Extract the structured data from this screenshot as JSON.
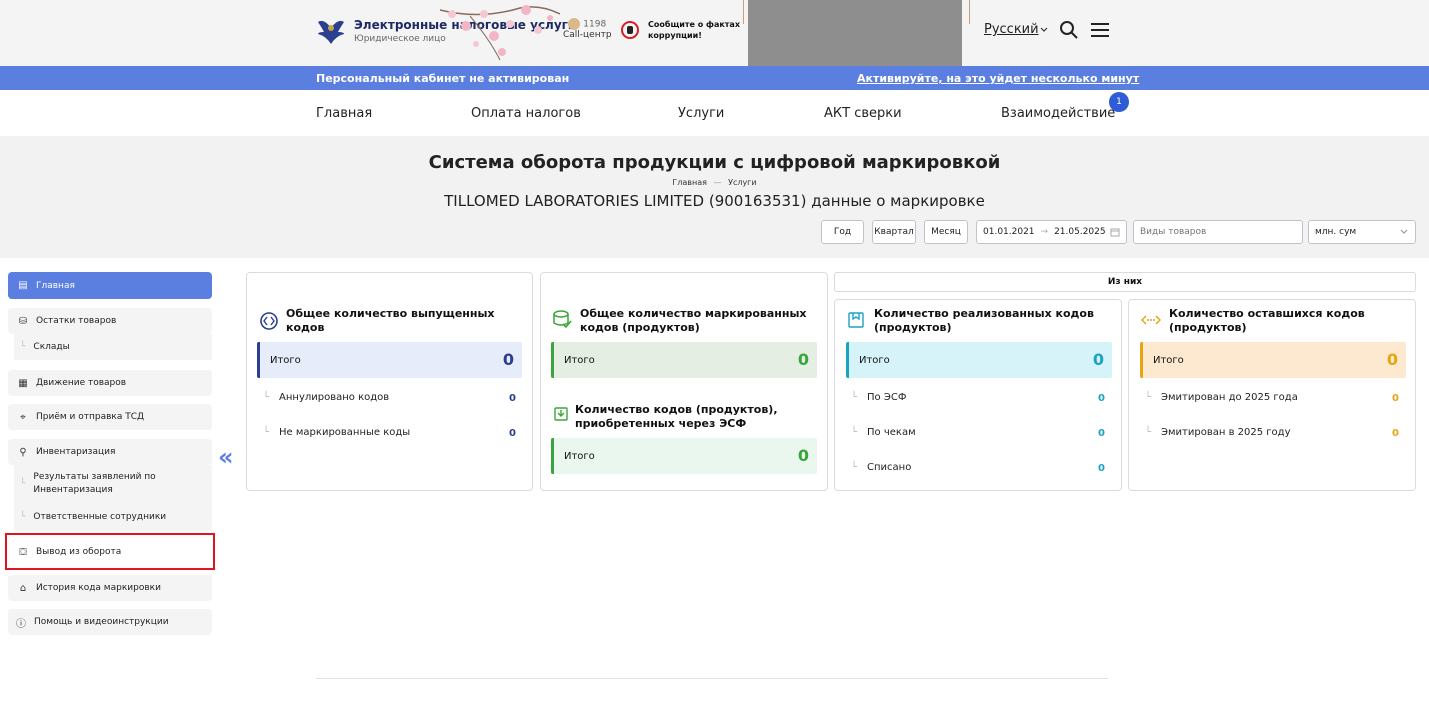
{
  "header": {
    "logo_title": "Электронные налоговые услуги",
    "logo_subtitle": "Юридическое лицо",
    "call_number": "1198",
    "call_label": "Call-центр",
    "report_line1": "Сообщите о фактах",
    "report_line2": "коррупции!",
    "language": "Русский"
  },
  "notice": {
    "left": "Персональный кабинет не активирован",
    "right": "Активируйте, на это уйдет несколько минут"
  },
  "nav": {
    "items": [
      "Главная",
      "Оплата налогов",
      "Услуги",
      "АКТ сверки",
      "Взаимодействие"
    ],
    "badge": "1"
  },
  "page": {
    "title": "Система оборота продукции с цифровой маркировкой",
    "breadcrumb_home": "Главная",
    "breadcrumb_sep": "—",
    "breadcrumb_current": "Услуги",
    "company": "TILLOMED LABORATORIES LIMITED (900163531) данные о маркировке"
  },
  "filters": {
    "year": "Год",
    "quarter": "Квартал",
    "month": "Месяц",
    "date_from": "01.01.2021",
    "date_arrow": "→",
    "date_to": "21.05.2025",
    "goods_placeholder": "Виды товаров",
    "unit": "млн. сум"
  },
  "sidebar": {
    "items": [
      "Главная",
      "Остатки товаров",
      "Склады",
      "Движение товаров",
      "Приём и отправка ТСД",
      "Инвентаризация",
      "Результаты заявлений по Инвентаризация",
      "Ответственные сотрудники",
      "Вывод из оборота",
      "История кода маркировки",
      "Помощь и видеоинструкции"
    ]
  },
  "cards": {
    "issued": {
      "title": "Общее количество выпущенных кодов",
      "total_label": "Итого",
      "total": "0",
      "rows": [
        {
          "label": "Аннулировано кодов",
          "value": "0"
        },
        {
          "label": "Не маркированные коды",
          "value": "0"
        }
      ]
    },
    "marked": {
      "title": "Общее количество маркированных кодов (продуктов)",
      "total_label": "Итого",
      "total": "0"
    },
    "purchased": {
      "title": "Количество кодов (продуктов), приобретенных через ЭСФ",
      "total_label": "Итого",
      "total": "0"
    },
    "from_them": "Из них",
    "sold": {
      "title": "Количество реализованных кодов (продуктов)",
      "total_label": "Итого",
      "total": "0",
      "rows": [
        {
          "label": "По ЭСФ",
          "value": "0"
        },
        {
          "label": "По чекам",
          "value": "0"
        },
        {
          "label": "Списано",
          "value": "0"
        }
      ]
    },
    "remaining": {
      "title": "Количество оставшихся кодов (продуктов)",
      "total_label": "Итого",
      "total": "0",
      "rows": [
        {
          "label": "Эмитирован до 2025 года",
          "value": "0"
        },
        {
          "label": "Эмитирован в 2025 году",
          "value": "0"
        }
      ]
    }
  },
  "colors": {
    "accent": "#5b7fe0",
    "highlight": "#e0161e"
  }
}
